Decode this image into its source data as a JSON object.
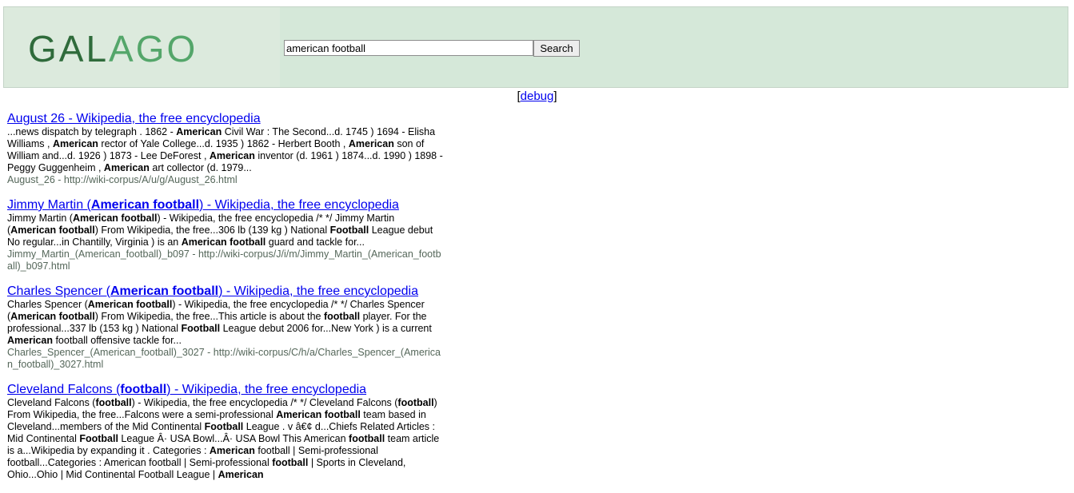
{
  "header": {
    "logo_part1": "GAL",
    "logo_part2": "A",
    "logo_part3": "GO",
    "search_value": "american football",
    "search_button": "Search"
  },
  "debug": {
    "open": "[",
    "label": "debug",
    "close": "]"
  },
  "results": [
    {
      "title": [
        {
          "t": "August 26 - Wikipedia, the free encyclopedia",
          "b": false
        }
      ],
      "snippet": [
        {
          "t": "...news dispatch by telegraph . 1862 - ",
          "b": false
        },
        {
          "t": "American",
          "b": true
        },
        {
          "t": " Civil War : The Second...d. 1745 ) 1694 - Elisha Williams , ",
          "b": false
        },
        {
          "t": "American",
          "b": true
        },
        {
          "t": " rector of Yale College...d. 1935 ) 1862 - Herbert Booth , ",
          "b": false
        },
        {
          "t": "American",
          "b": true
        },
        {
          "t": " son of William and...d. 1926 ) 1873 - Lee DeForest , ",
          "b": false
        },
        {
          "t": "American",
          "b": true
        },
        {
          "t": " inventor (d. 1961 ) 1874...d. 1990 ) 1898 - Peggy Guggenheim , ",
          "b": false
        },
        {
          "t": "American",
          "b": true
        },
        {
          "t": " art collector (d. 1979...",
          "b": false
        }
      ],
      "url": "August_26 - http://wiki-corpus/A/u/g/August_26.html"
    },
    {
      "title": [
        {
          "t": "Jimmy Martin (",
          "b": false
        },
        {
          "t": "American football",
          "b": true
        },
        {
          "t": ") - Wikipedia, the free encyclopedia",
          "b": false
        }
      ],
      "snippet": [
        {
          "t": "Jimmy Martin (",
          "b": false
        },
        {
          "t": "American football",
          "b": true
        },
        {
          "t": ") - Wikipedia, the free encyclopedia /* */ Jimmy Martin (",
          "b": false
        },
        {
          "t": "American football",
          "b": true
        },
        {
          "t": ") From Wikipedia, the free...306  lb (139  kg ) National ",
          "b": false
        },
        {
          "t": "Football",
          "b": true
        },
        {
          "t": " League debut No regular...in Chantilly, Virginia ) is an ",
          "b": false
        },
        {
          "t": "American football",
          "b": true
        },
        {
          "t": " guard and tackle for...",
          "b": false
        }
      ],
      "url": "Jimmy_Martin_(American_football)_b097 - http://wiki-corpus/J/i/m/Jimmy_Martin_(American_football)_b097.html"
    },
    {
      "title": [
        {
          "t": "Charles Spencer (",
          "b": false
        },
        {
          "t": "American football",
          "b": true
        },
        {
          "t": ") - Wikipedia, the free encyclopedia",
          "b": false
        }
      ],
      "snippet": [
        {
          "t": "Charles Spencer (",
          "b": false
        },
        {
          "t": "American football",
          "b": true
        },
        {
          "t": ") - Wikipedia, the free encyclopedia /* */ Charles Spencer (",
          "b": false
        },
        {
          "t": "American football",
          "b": true
        },
        {
          "t": ") From Wikipedia, the free...This article is about the ",
          "b": false
        },
        {
          "t": "football",
          "b": true
        },
        {
          "t": " player. For the professional...337  lb (153  kg ) National ",
          "b": false
        },
        {
          "t": "Football",
          "b": true
        },
        {
          "t": " League debut 2006 for...New York ) is a current ",
          "b": false
        },
        {
          "t": "American",
          "b": true
        },
        {
          "t": " football offensive tackle for...",
          "b": false
        }
      ],
      "url": "Charles_Spencer_(American_football)_3027 - http://wiki-corpus/C/h/a/Charles_Spencer_(American_football)_3027.html"
    },
    {
      "title": [
        {
          "t": "Cleveland Falcons (",
          "b": false
        },
        {
          "t": "football",
          "b": true
        },
        {
          "t": ") - Wikipedia, the free encyclopedia",
          "b": false
        }
      ],
      "snippet": [
        {
          "t": "Cleveland Falcons (",
          "b": false
        },
        {
          "t": "football",
          "b": true
        },
        {
          "t": ") - Wikipedia, the free encyclopedia /* */ Cleveland Falcons (",
          "b": false
        },
        {
          "t": "football",
          "b": true
        },
        {
          "t": ") From Wikipedia, the free...Falcons were a semi-professional ",
          "b": false
        },
        {
          "t": "American football",
          "b": true
        },
        {
          "t": " team based in Cleveland...members of the Mid Continental ",
          "b": false
        },
        {
          "t": "Football",
          "b": true
        },
        {
          "t": " League . v   â€¢ d...Chiefs Related Articles : Mid Continental ",
          "b": false
        },
        {
          "t": "Football",
          "b": true
        },
        {
          "t": " League  Â· USA Bowl...Â· USA Bowl  This American ",
          "b": false
        },
        {
          "t": "football",
          "b": true
        },
        {
          "t": " team article is a...Wikipedia by expanding it . Categories : ",
          "b": false
        },
        {
          "t": "American",
          "b": true
        },
        {
          "t": " football | Semi-professional football...Categories : American football | Semi-professional ",
          "b": false
        },
        {
          "t": "football",
          "b": true
        },
        {
          "t": " | Sports in Cleveland, Ohio...Ohio | Mid Continental Football League | ",
          "b": false
        },
        {
          "t": "American",
          "b": true
        }
      ],
      "url": ""
    }
  ]
}
